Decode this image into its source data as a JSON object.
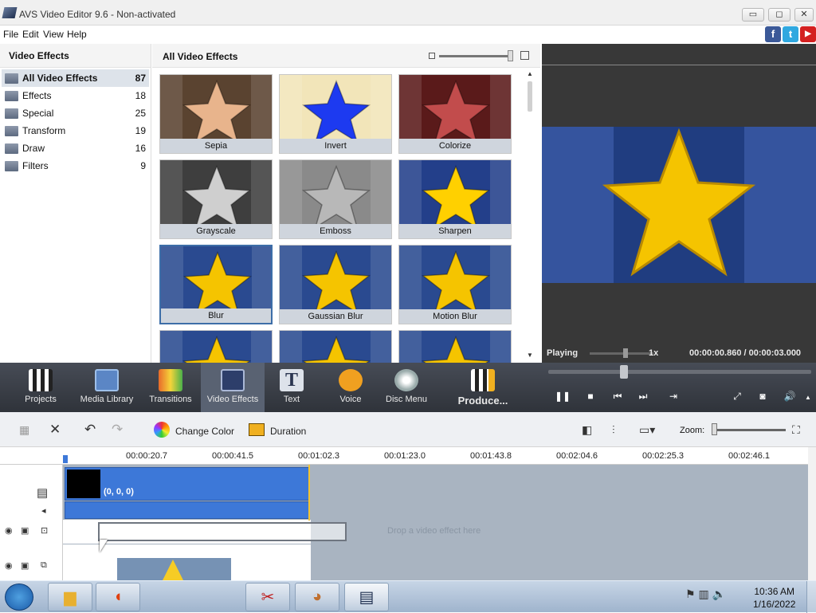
{
  "window": {
    "title": "AVS Video Editor 9.6 - Non-activated",
    "minimize": "▭",
    "maximize": "◻",
    "close": "✕"
  },
  "menu": [
    "File",
    "Edit",
    "View",
    "Help"
  ],
  "social": {
    "facebook": "f",
    "twitter": "t",
    "youtube": "▶"
  },
  "left_panel": {
    "title": "Video Effects",
    "categories": [
      {
        "label": "All Video Effects",
        "count": "87",
        "selected": true
      },
      {
        "label": "Effects",
        "count": "18"
      },
      {
        "label": "Special",
        "count": "25"
      },
      {
        "label": "Transform",
        "count": "19"
      },
      {
        "label": "Draw",
        "count": "16"
      },
      {
        "label": "Filters",
        "count": "9"
      }
    ]
  },
  "effects_panel": {
    "title": "All Video Effects",
    "scroll_up": "▲",
    "scroll_down": "▼",
    "tiles": [
      {
        "label": "Sepia",
        "bg": "#5a4330",
        "star": "#e8b48c"
      },
      {
        "label": "Invert",
        "bg": "#f2e5b9",
        "star": "#1d3af0"
      },
      {
        "label": "Colorize",
        "bg": "#5a1a1a",
        "star": "#c24c4c"
      },
      {
        "label": "Grayscale",
        "bg": "#3e3e3e",
        "star": "#cfcfcf"
      },
      {
        "label": "Emboss",
        "bg": "#8a8a8a",
        "star": "#b8b8b8"
      },
      {
        "label": "Sharpen",
        "bg": "#233f8a",
        "star": "#ffd000"
      },
      {
        "label": "Blur",
        "bg": "#2a4a90",
        "star": "#f5c400",
        "selected": true
      },
      {
        "label": "Gaussian Blur",
        "bg": "#2a4a90",
        "star": "#f5c400"
      },
      {
        "label": "Motion Blur",
        "bg": "#2a4a90",
        "star": "#f5c400"
      },
      {
        "label": "",
        "bg": "#2a4a90",
        "star": "#f5c400"
      },
      {
        "label": "",
        "bg": "#2a4a90",
        "star": "#f5c400"
      },
      {
        "label": "",
        "bg": "#2a4a90",
        "star": "#f5c400"
      }
    ]
  },
  "preview": {
    "status": "Playing",
    "speed": "1x",
    "time": "00:00:00.860 / 00:00:03.000"
  },
  "toolbar": {
    "tools": [
      "Projects",
      "Media Library",
      "Transitions",
      "Video Effects",
      "Text",
      "Voice",
      "Disc Menu",
      "Produce..."
    ],
    "active": "Video Effects"
  },
  "playback": {
    "pause": "❚❚",
    "stop": "■",
    "prev": "⏮",
    "next": "⏭",
    "loop": "⇥",
    "fullscreen": "⤢",
    "snapshot": "◙",
    "volume": "🔊",
    "volume_up": "▲"
  },
  "edit_bar": {
    "change_color": "Change Color",
    "duration": "Duration",
    "zoom_label": "Zoom:"
  },
  "timeline": {
    "ticks": [
      "00:00:20.7",
      "00:00:41.5",
      "00:01:02.3",
      "00:01:23.0",
      "00:01:43.8",
      "00:02:04.6",
      "00:02:25.3",
      "00:02:46.1"
    ],
    "clip_label": "(0, 0, 0)",
    "drop_hint": "Drop a video effect here"
  },
  "taskbar": {
    "time": "10:36 AM",
    "date": "1/16/2022"
  },
  "colors": {
    "accent": "#3d78d8",
    "toolbar": "#3a3f47"
  }
}
